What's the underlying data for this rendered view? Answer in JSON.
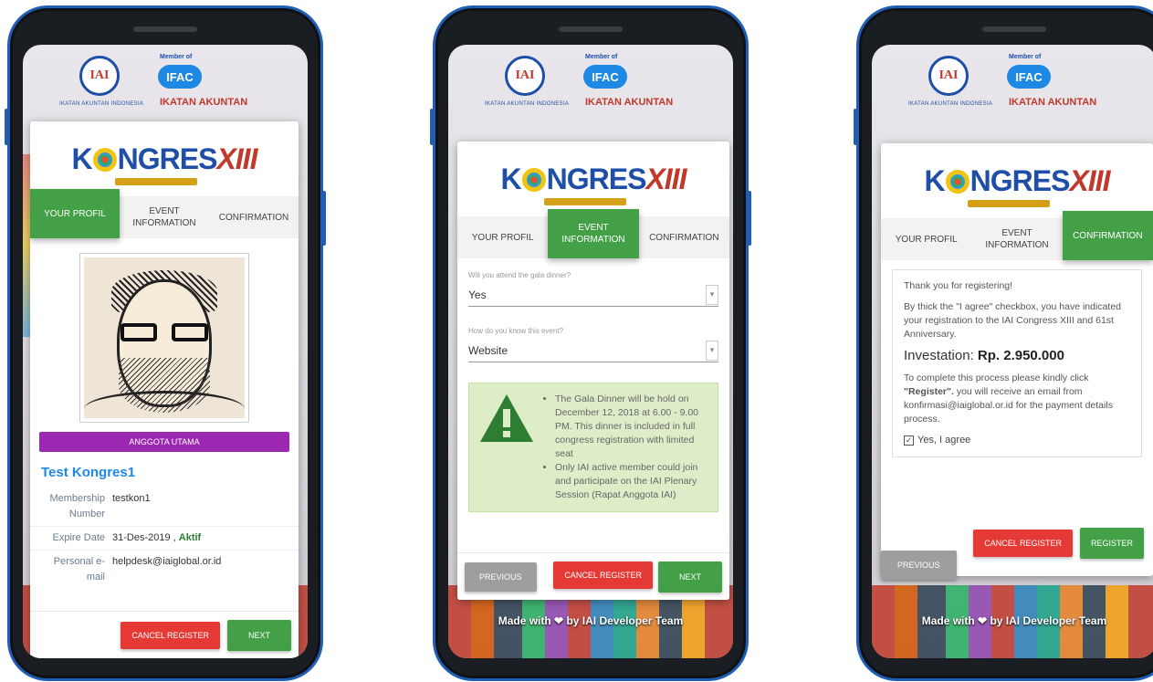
{
  "background": {
    "member_of": "Member of",
    "ifac": "IFAC",
    "iai": "IAI",
    "iai_text": "IKATAN AKUNTAN INDONESIA",
    "ikatan": "IKATAN AKUNTAN",
    "made_with": "Made with ❤ by IAI Developer Team"
  },
  "logo": {
    "k": "K",
    "ngres": "NGRES",
    "xiii": "XIII"
  },
  "tabs": {
    "profile": "YOUR PROFIL",
    "event": "EVENT INFORMATION",
    "confirm": "CONFIRMATION"
  },
  "screen1": {
    "role": "ANGGOTA UTAMA",
    "name": "Test Kongres1",
    "rows": [
      {
        "label": "Membership Number",
        "value": "testkon1"
      },
      {
        "label": "Expire Date",
        "value": "31-Des-2019 ,",
        "status": "Aktif"
      },
      {
        "label": "Personal e-mail",
        "value": "helpdesk@iaiglobal.or.id"
      }
    ],
    "cancel": "CANCEL REGISTER",
    "next": "NEXT"
  },
  "screen2": {
    "q1_label": "Will you attend the gala dinner?",
    "q1_value": "Yes",
    "q2_label": "How do you know this event?",
    "q2_value": "Website",
    "bullet1": "The Gala Dinner will be hold on December 12, 2018 at 6.00 - 9.00 PM. This dinner is included in full congress registration with limited seat",
    "bullet2": "Only IAI active member could join and participate on the IAI Plenary Session (Rapat Anggota IAI)",
    "previous": "PREVIOUS",
    "cancel": "CANCEL REGISTER",
    "next": "NEXT"
  },
  "screen3": {
    "thanks": "Thank you for registering!",
    "agree_text": "By thick the \"I agree\" checkbox, you have indicated your registration to the IAI Congress XIII and 61st Anniversary.",
    "invest_label": "Investation:",
    "invest_value": "Rp. 2.950.000",
    "complete_a": "To complete this process please kindly click",
    "complete_b": "\"Register\".",
    "complete_c": "you will receive an email from konfirmasi@iaiglobal.or.id for the payment details process.",
    "check_label": "Yes, I agree",
    "cancel": "CANCEL REGISTER",
    "register": "REGISTER",
    "previous": "PREVIOUS"
  },
  "colors": {
    "green": "#43a047",
    "red": "#e53935",
    "purple": "#9c27b0",
    "blue": "#1e88e5"
  }
}
